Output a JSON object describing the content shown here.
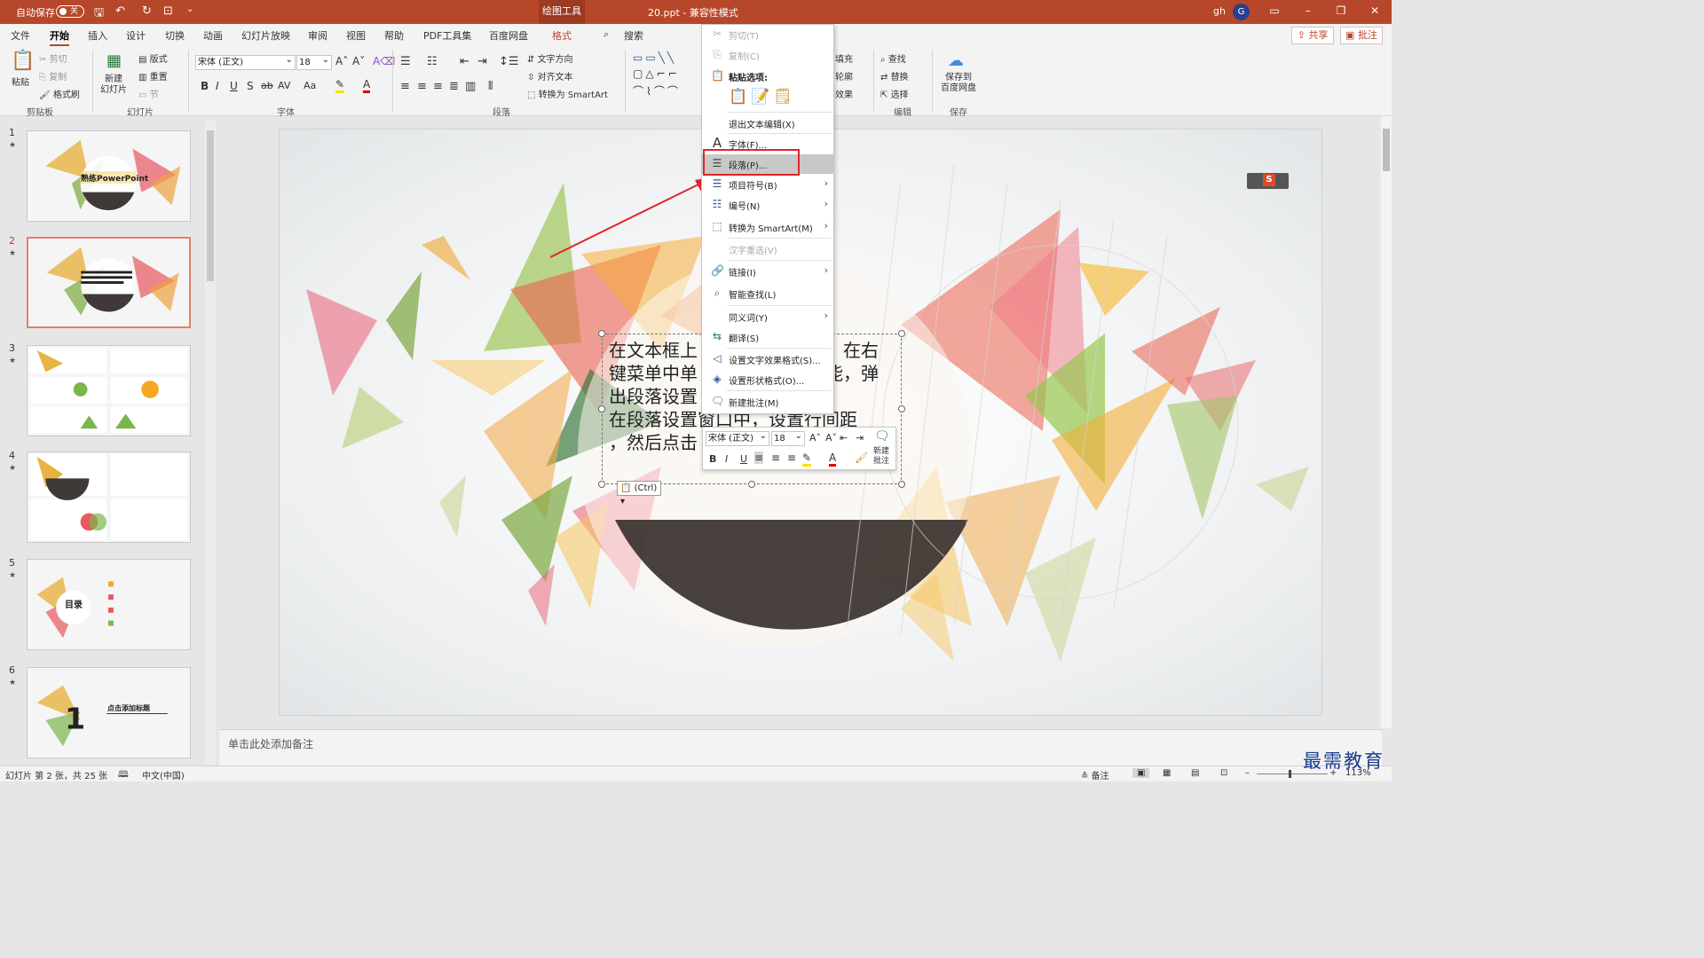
{
  "titlebar": {
    "autosave_label": "自动保存",
    "autosave_state": "关",
    "tool_tab": "绘图工具",
    "doc_title": "20.ppt  -  兼容性模式",
    "user": "gh",
    "avatar": "G"
  },
  "tabs": [
    "文件",
    "开始",
    "插入",
    "设计",
    "切换",
    "动画",
    "幻灯片放映",
    "审阅",
    "视图",
    "帮助",
    "PDF工具集",
    "百度网盘",
    "格式"
  ],
  "search_label": "搜索",
  "share_label": "共享",
  "comment_label": "批注",
  "ribbon": {
    "paste": "粘贴",
    "cut": "剪切",
    "copy": "复制",
    "format_painter": "格式刷",
    "new_slide": "新建\n幻灯片",
    "layout": "版式",
    "reset": "重置",
    "section": "节",
    "font_name": "宋体 (正文)",
    "font_size": "18",
    "text_direction": "文字方向",
    "align_text": "对齐文本",
    "convert_smartart": "转换为 SmartArt",
    "fill": "填充",
    "outline": "轮廓",
    "effect": "效果",
    "find": "查找",
    "replace": "替换",
    "select": "选择",
    "save_baidu": "保存到\n百度网盘",
    "groups": {
      "clipboard": "剪贴板",
      "slides": "幻灯片",
      "font": "字体",
      "paragraph": "段落",
      "editing": "编辑",
      "save": "保存"
    }
  },
  "thumbnails": [
    {
      "num": "1",
      "title": "熟练PowerPoint"
    },
    {
      "num": "2",
      "title": ""
    },
    {
      "num": "3",
      "title": ""
    },
    {
      "num": "4",
      "title": ""
    },
    {
      "num": "5",
      "title": "目录"
    },
    {
      "num": "6",
      "title": "点击添加标题"
    }
  ],
  "slide_text": "在文本框上单击鼠标右键，在右键菜单中单击段落功能，弹出段落设置窗口，在段落设置窗口中，设置行间距，然后点击确定。",
  "slide_text_lines": [
    "在文本框上",
    "键菜单中单",
    "出段落设置",
    "在段落设置窗口中，设置行间距",
    "，然后点击"
  ],
  "slide_text_right": [
    "在右",
    "能，弹"
  ],
  "ctrl_tag": "(Ctrl)",
  "context_menu": {
    "items": [
      {
        "icon": "scissors-icon",
        "label": "剪切(T)",
        "disabled": true
      },
      {
        "icon": "copy-icon",
        "label": "复制(C)",
        "disabled": true
      },
      {
        "icon": "paste-icon",
        "label": "粘贴选项:",
        "bold": true
      },
      {
        "icon": "",
        "label": "退出文本编辑(X)"
      },
      {
        "icon": "font-icon",
        "label": "字体(F)..."
      },
      {
        "icon": "paragraph-icon",
        "label": "段落(P)...",
        "highlighted": true
      },
      {
        "icon": "bullets-icon",
        "label": "项目符号(B)",
        "submenu": true
      },
      {
        "icon": "numbering-icon",
        "label": "编号(N)",
        "submenu": true
      },
      {
        "icon": "smartart-icon",
        "label": "转换为 SmartArt(M)",
        "submenu": true
      },
      {
        "icon": "",
        "label": "汉字重选(V)",
        "disabled": true
      },
      {
        "icon": "link-icon",
        "label": "链接(I)",
        "submenu": true
      },
      {
        "icon": "smart-lookup-icon",
        "label": "智能查找(L)"
      },
      {
        "icon": "",
        "label": "同义词(Y)",
        "submenu": true
      },
      {
        "icon": "translate-icon",
        "label": "翻译(S)"
      },
      {
        "icon": "text-effects-icon",
        "label": "设置文字效果格式(S)..."
      },
      {
        "icon": "shape-format-icon",
        "label": "设置形状格式(O)..."
      },
      {
        "icon": "new-comment-icon",
        "label": "新建批注(M)"
      }
    ]
  },
  "mini_toolbar": {
    "font": "宋体 (正文)",
    "size": "18",
    "new_comment": "新建\n批注"
  },
  "notes_placeholder": "单击此处添加备注",
  "status": {
    "slide_info": "幻灯片 第 2 张，共 25 张",
    "language": "中文(中国)",
    "notes": "备注",
    "zoom": "113%"
  },
  "watermark": "最需教育",
  "colors": {
    "accent": "#b7472a",
    "highlight_box": "#e1242b"
  }
}
